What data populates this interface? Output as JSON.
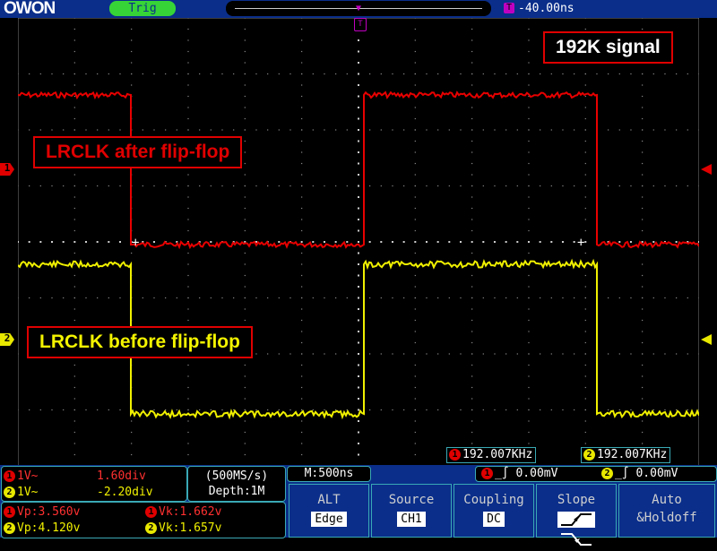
{
  "header": {
    "logo": "OWON",
    "trigger_status": "Trig",
    "trigger_delay_icon": "T",
    "trigger_delay": "-40.00ns",
    "trigger_marker": "T"
  },
  "screen": {
    "ch1_marker": "1",
    "ch2_marker": "2",
    "signal_label": "192K signal",
    "ch1_annotation": "LRCLK after flip-flop",
    "ch2_annotation": "LRCLK before flip-flop",
    "ch1_freq": "192.007KHz",
    "ch2_freq": "192.007KHz",
    "ch1_color": "#e00000",
    "ch2_color": "#e8e800"
  },
  "channel_panel": {
    "ch1": {
      "badge": "1",
      "scale": "1V~",
      "position": "1.60div"
    },
    "ch2": {
      "badge": "2",
      "scale": "1V~",
      "position": "-2.20div"
    }
  },
  "timebase_panel": {
    "sample_rate": "(500MS/s)",
    "depth": "Depth:1M"
  },
  "measure_panel": {
    "ch1_vp": "Vp:3.560v",
    "ch1_vk": "Vk:1.662v",
    "ch2_vp": "Vp:4.120v",
    "ch2_vk": "Vk:1.657v"
  },
  "memory": "M:500ns",
  "trigger_levels": {
    "ch1_level": "0.00mV",
    "ch2_level": "0.00mV"
  },
  "menu": {
    "alt": {
      "title": "ALT",
      "value": "Edge"
    },
    "source": {
      "title": "Source",
      "value": "CH1"
    },
    "coupling": {
      "title": "Coupling",
      "value": "DC"
    },
    "slope": {
      "title": "Slope"
    },
    "auto": {
      "title": "Auto",
      "value": "&Holdoff"
    }
  }
}
